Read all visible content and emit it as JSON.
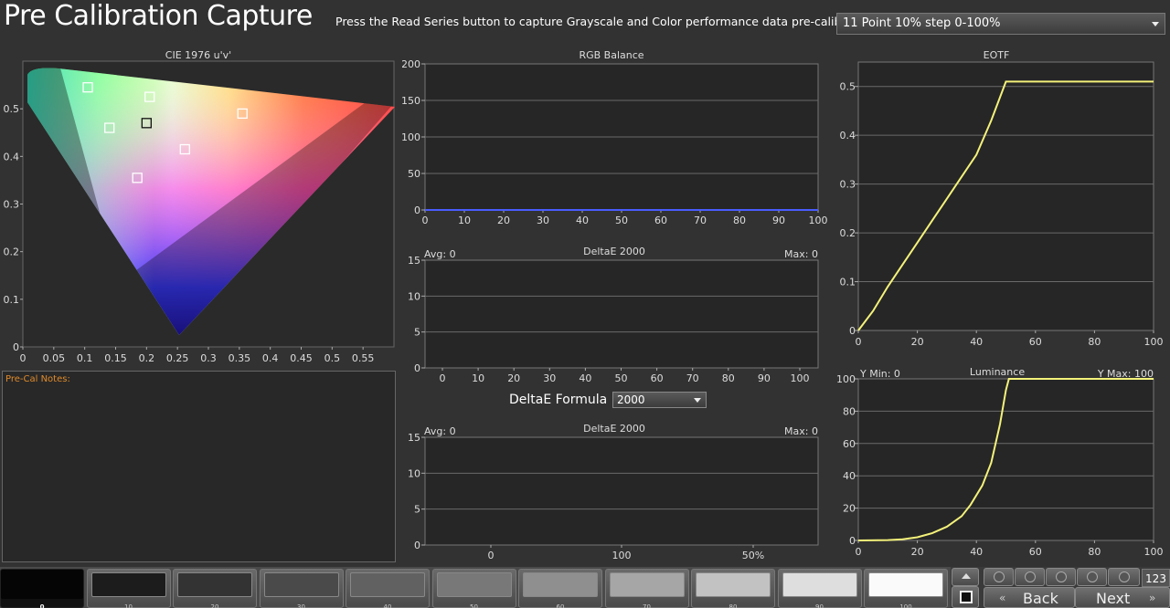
{
  "header": {
    "title": "Pre Calibration Capture",
    "instruction": "Press the Read Series button to capture Grayscale and Color performance data pre-calibration.",
    "series_selected": "11 Point 10% step 0-100%"
  },
  "cie": {
    "title": "CIE 1976 u'v'",
    "x_ticks": [
      "0",
      "0.05",
      "0.1",
      "0.15",
      "0.2",
      "0.25",
      "0.3",
      "0.35",
      "0.4",
      "0.45",
      "0.5",
      "0.55"
    ],
    "y_ticks": [
      "0",
      "0.1",
      "0.2",
      "0.3",
      "0.4",
      "0.5"
    ]
  },
  "notes": {
    "label": "Pre-Cal Notes:"
  },
  "rgb_balance": {
    "title": "RGB Balance",
    "x_ticks": [
      "0",
      "10",
      "20",
      "30",
      "40",
      "50",
      "60",
      "70",
      "80",
      "90",
      "100"
    ],
    "y_ticks": [
      "0",
      "50",
      "100",
      "150",
      "200"
    ]
  },
  "deltae_gray": {
    "title": "DeltaE 2000",
    "avg": "Avg: 0",
    "max": "Max: 0",
    "x_ticks": [
      "0",
      "10",
      "20",
      "30",
      "40",
      "50",
      "60",
      "70",
      "80",
      "90",
      "100"
    ],
    "y_ticks": [
      "0",
      "5",
      "10",
      "15"
    ]
  },
  "formula": {
    "label": "DeltaE Formula",
    "selected": "2000"
  },
  "deltae_color": {
    "title": "DeltaE 2000",
    "avg": "Avg: 0",
    "max": "Max: 0",
    "x_ticks": [
      "0",
      "100",
      "50%"
    ],
    "y_ticks": [
      "0",
      "5",
      "10",
      "15"
    ]
  },
  "eotf": {
    "title": "EOTF",
    "x_ticks": [
      "0",
      "20",
      "40",
      "60",
      "80",
      "100"
    ],
    "y_ticks": [
      "0",
      "0.1",
      "0.2",
      "0.3",
      "0.4",
      "0.5"
    ]
  },
  "luminance": {
    "title": "Luminance",
    "ymin": "Y Min: 0",
    "ymax": "Y Max: 100",
    "x_ticks": [
      "0",
      "20",
      "40",
      "60",
      "80",
      "100"
    ],
    "y_ticks": [
      "0",
      "20",
      "40",
      "60",
      "80",
      "100"
    ]
  },
  "swatches": [
    "0",
    "10",
    "20",
    "30",
    "40",
    "50",
    "60",
    "70",
    "80",
    "90",
    "100"
  ],
  "swatch_colors": [
    "#050505",
    "#1c1c1c",
    "#333333",
    "#4a4a4a",
    "#616161",
    "#787878",
    "#8f8f8f",
    "#a6a6a6",
    "#c2c2c2",
    "#dedede",
    "#fafafa"
  ],
  "controls": {
    "back_label": "Back",
    "next_label": "Next",
    "count": "123"
  },
  "chart_data": [
    {
      "type": "scatter",
      "title": "CIE 1976 u'v'",
      "xlim": [
        0,
        0.6
      ],
      "ylim": [
        0,
        0.6
      ],
      "series": [
        {
          "points": [
            [
              0.105,
              0.545
            ],
            [
              0.205,
              0.525
            ],
            [
              0.14,
              0.46
            ],
            [
              0.2,
              0.47
            ],
            [
              0.355,
              0.49
            ],
            [
              0.262,
              0.415
            ],
            [
              0.185,
              0.355
            ]
          ]
        }
      ]
    },
    {
      "type": "line",
      "title": "RGB Balance",
      "xlim": [
        0,
        100
      ],
      "ylim": [
        0,
        200
      ],
      "x": [
        0,
        10,
        20,
        30,
        40,
        50,
        60,
        70,
        80,
        90,
        100
      ],
      "series": [
        {
          "values": [
            0,
            0,
            0,
            0,
            0,
            0,
            0,
            0,
            0,
            0,
            0
          ],
          "color": "#4a5cff"
        }
      ]
    },
    {
      "type": "bar",
      "title": "DeltaE 2000",
      "xlim": [
        0,
        100
      ],
      "ylim": [
        0,
        15
      ],
      "categories": [
        "0",
        "10",
        "20",
        "30",
        "40",
        "50",
        "60",
        "70",
        "80",
        "90",
        "100"
      ],
      "values": [
        0,
        0,
        0,
        0,
        0,
        0,
        0,
        0,
        0,
        0,
        0
      ]
    },
    {
      "type": "bar",
      "title": "DeltaE 2000",
      "ylim": [
        0,
        15
      ],
      "categories": [
        "0",
        "100",
        "50%"
      ],
      "values": [
        0,
        0,
        0
      ]
    },
    {
      "type": "line",
      "title": "EOTF",
      "xlim": [
        0,
        100
      ],
      "ylim": [
        0,
        0.55
      ],
      "x": [
        0,
        5,
        10,
        15,
        20,
        25,
        30,
        35,
        40,
        45,
        50,
        51,
        60,
        70,
        80,
        90,
        100
      ],
      "series": [
        {
          "values": [
            0,
            0.04,
            0.09,
            0.135,
            0.18,
            0.225,
            0.27,
            0.315,
            0.36,
            0.43,
            0.51,
            0.51,
            0.51,
            0.51,
            0.51,
            0.51,
            0.51
          ],
          "color": "#f4f27a"
        }
      ]
    },
    {
      "type": "line",
      "title": "Luminance",
      "xlim": [
        0,
        100
      ],
      "ylim": [
        0,
        100
      ],
      "x": [
        0,
        10,
        15,
        20,
        25,
        30,
        35,
        38,
        42,
        45,
        48,
        50,
        51,
        60,
        70,
        80,
        90,
        100
      ],
      "series": [
        {
          "values": [
            0,
            0.2,
            0.7,
            2,
            4.5,
            8.5,
            15,
            22,
            34,
            48,
            72,
            93,
            100,
            100,
            100,
            100,
            100,
            100
          ],
          "color": "#f4f27a"
        }
      ]
    }
  ]
}
